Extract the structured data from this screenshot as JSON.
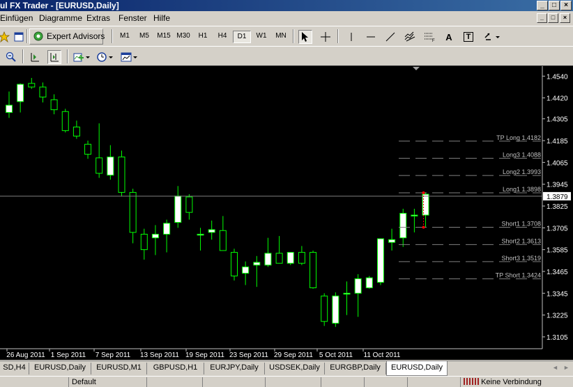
{
  "window": {
    "title": "ul FX Trader - [EURUSD,Daily]",
    "buttons": [
      "_",
      "□",
      "×"
    ]
  },
  "menu": {
    "items": [
      "Einfügen",
      "Diagramme",
      "Extras",
      "Fenster",
      "Hilfe"
    ],
    "mdi_buttons": [
      "_",
      "□",
      "×"
    ]
  },
  "toolbar": {
    "expert_advisors_label": "Expert Advisors",
    "timeframes": [
      "M1",
      "M5",
      "M15",
      "M30",
      "H1",
      "H4",
      "D1",
      "W1",
      "MN"
    ],
    "active_timeframe": "D1",
    "text_tool": "A",
    "label_tool": "T"
  },
  "chart_data": {
    "type": "candlestick",
    "symbol": "EURUSD",
    "timeframe": "Daily",
    "ylim": [
      1.3055,
      1.4595
    ],
    "y_ticks": [
      "1.4540",
      "1.4420",
      "1.4305",
      "1.4185",
      "1.4065",
      "1.3945",
      "1.3825",
      "1.3705",
      "1.3585",
      "1.3465",
      "1.3345",
      "1.3225",
      "1.3105"
    ],
    "x_ticks": [
      "26 Aug 2011",
      "1 Sep 2011",
      "7 Sep 2011",
      "13 Sep 2011",
      "19 Sep 2011",
      "23 Sep 2011",
      "29 Sep 2011",
      "5 Oct 2011",
      "11 Oct 2011"
    ],
    "current_price": "1.3879",
    "candles": [
      {
        "o": 1.434,
        "h": 1.4455,
        "l": 1.431,
        "c": 1.438
      },
      {
        "o": 1.44,
        "h": 1.45,
        "l": 1.434,
        "c": 1.4495
      },
      {
        "o": 1.45,
        "h": 1.453,
        "l": 1.447,
        "c": 1.448
      },
      {
        "o": 1.448,
        "h": 1.4505,
        "l": 1.4395,
        "c": 1.4425
      },
      {
        "o": 1.441,
        "h": 1.444,
        "l": 1.433,
        "c": 1.4355
      },
      {
        "o": 1.4345,
        "h": 1.436,
        "l": 1.423,
        "c": 1.424
      },
      {
        "o": 1.426,
        "h": 1.4295,
        "l": 1.4195,
        "c": 1.421
      },
      {
        "o": 1.4165,
        "h": 1.4185,
        "l": 1.4085,
        "c": 1.411
      },
      {
        "o": 1.409,
        "h": 1.428,
        "l": 1.398,
        "c": 1.4005
      },
      {
        "o": 1.3995,
        "h": 1.416,
        "l": 1.397,
        "c": 1.4095
      },
      {
        "o": 1.4095,
        "h": 1.413,
        "l": 1.388,
        "c": 1.39
      },
      {
        "o": 1.39,
        "h": 1.392,
        "l": 1.362,
        "c": 1.368
      },
      {
        "o": 1.367,
        "h": 1.37,
        "l": 1.353,
        "c": 1.3585
      },
      {
        "o": 1.365,
        "h": 1.372,
        "l": 1.3555,
        "c": 1.367
      },
      {
        "o": 1.367,
        "h": 1.375,
        "l": 1.357,
        "c": 1.373
      },
      {
        "o": 1.3735,
        "h": 1.3935,
        "l": 1.3705,
        "c": 1.388
      },
      {
        "o": 1.3875,
        "h": 1.389,
        "l": 1.375,
        "c": 1.379
      },
      {
        "o": 1.3665,
        "h": 1.3705,
        "l": 1.358,
        "c": 1.367
      },
      {
        "o": 1.368,
        "h": 1.3745,
        "l": 1.364,
        "c": 1.3695
      },
      {
        "o": 1.369,
        "h": 1.377,
        "l": 1.358,
        "c": 1.358
      },
      {
        "o": 1.357,
        "h": 1.359,
        "l": 1.3415,
        "c": 1.344
      },
      {
        "o": 1.3455,
        "h": 1.352,
        "l": 1.339,
        "c": 1.349
      },
      {
        "o": 1.35,
        "h": 1.355,
        "l": 1.338,
        "c": 1.3515
      },
      {
        "o": 1.35,
        "h": 1.365,
        "l": 1.349,
        "c": 1.3565
      },
      {
        "o": 1.3565,
        "h": 1.366,
        "l": 1.351,
        "c": 1.351
      },
      {
        "o": 1.351,
        "h": 1.357,
        "l": 1.35,
        "c": 1.357
      },
      {
        "o": 1.357,
        "h": 1.3605,
        "l": 1.35,
        "c": 1.351
      },
      {
        "o": 1.357,
        "h": 1.358,
        "l": 1.337,
        "c": 1.3375
      },
      {
        "o": 1.333,
        "h": 1.3345,
        "l": 1.3165,
        "c": 1.319
      },
      {
        "o": 1.318,
        "h": 1.335,
        "l": 1.316,
        "c": 1.333
      },
      {
        "o": 1.334,
        "h": 1.341,
        "l": 1.3225,
        "c": 1.3345
      },
      {
        "o": 1.3345,
        "h": 1.345,
        "l": 1.3215,
        "c": 1.3425
      },
      {
        "o": 1.3375,
        "h": 1.344,
        "l": 1.337,
        "c": 1.343
      },
      {
        "o": 1.3405,
        "h": 1.364,
        "l": 1.339,
        "c": 1.3645
      },
      {
        "o": 1.3625,
        "h": 1.37,
        "l": 1.358,
        "c": 1.364
      },
      {
        "o": 1.365,
        "h": 1.381,
        "l": 1.36,
        "c": 1.3785
      },
      {
        "o": 1.377,
        "h": 1.381,
        "l": 1.368,
        "c": 1.3775
      },
      {
        "o": 1.3775,
        "h": 1.39,
        "l": 1.371,
        "c": 1.389
      }
    ]
  },
  "levels": [
    {
      "label": "TP Long",
      "value": "1.4182"
    },
    {
      "label": "Long3",
      "value": "1.4088"
    },
    {
      "label": "Long2",
      "value": "1.3993"
    },
    {
      "label": "Long1",
      "value": "1.3898"
    },
    {
      "label": "Short1",
      "value": "1.3708"
    },
    {
      "label": "Short2",
      "value": "1.3613"
    },
    {
      "label": "Short3",
      "value": "1.3519"
    },
    {
      "label": "TP Short",
      "value": "1.3424"
    }
  ],
  "tabs": {
    "items": [
      "SD,H4",
      "EURUSD,Daily",
      "EURUSD,M1",
      "GBPUSD,H1",
      "EURJPY,Daily",
      "USDSEK,Daily",
      "EURGBP,Daily",
      "EURUSD,Daily"
    ],
    "active_index": 7
  },
  "status": {
    "profile": "Default",
    "connection": "Keine Verbindung"
  },
  "colors": {
    "chart_background": "#000000",
    "bull_candle": "#ffffff",
    "bear_candle": "#000000",
    "wick": "#00ff00",
    "level_line": "#808080",
    "level_label": "#c0c0c0",
    "current_price_line": "#808080",
    "entry_marker": "#ff0000"
  }
}
